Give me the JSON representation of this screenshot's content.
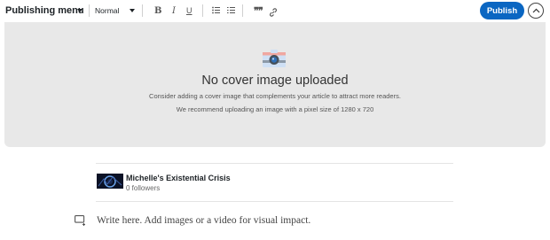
{
  "toolbar": {
    "menu_label": "Publishing menu",
    "style_select": "Normal",
    "bold_label": "B",
    "italic_label": "I",
    "underline_label": "U",
    "quote_label": "❞❞",
    "publish_label": "Publish",
    "icons": [
      "chevron-down-icon",
      "bullet-list-icon",
      "numbered-list-icon",
      "quote-icon",
      "link-icon",
      "chevron-up-icon"
    ]
  },
  "cover": {
    "title": "No cover image uploaded",
    "line1": "Consider adding a cover image that complements your article to attract more readers.",
    "line2": "We recommend uploading an image with a pixel size of 1280 x 720",
    "icon": "camera-icon"
  },
  "author": {
    "name": "Michelle's Existential Crisis",
    "followers": "0 followers"
  },
  "editor": {
    "placeholder": "Write here. Add images or a video for visual impact.",
    "icon": "insert-media-icon"
  },
  "colors": {
    "accent": "#0a66c2",
    "cover_bg": "#e8e8e8"
  }
}
